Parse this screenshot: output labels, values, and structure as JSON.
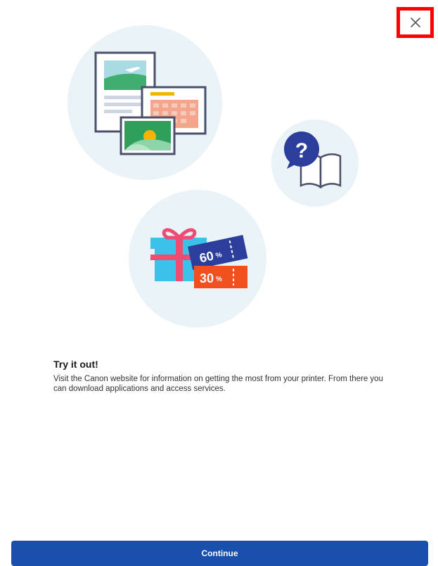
{
  "close": {
    "icon": "close-icon",
    "highlight_color": "#ff0000"
  },
  "illustrations": {
    "documents_icon": "documents-photo-calendar-illustration",
    "help_icon": "help-book-illustration",
    "offers_icon": "gift-coupons-illustration",
    "coupon_top": "60",
    "coupon_bottom": "30",
    "percent_sign": "%"
  },
  "content": {
    "title": "Try it out!",
    "description": "Visit the Canon website for information on getting the most from your printer. From there you can download applications and access services."
  },
  "actions": {
    "continue_label": "Continue",
    "primary_color": "#1b4fae"
  }
}
